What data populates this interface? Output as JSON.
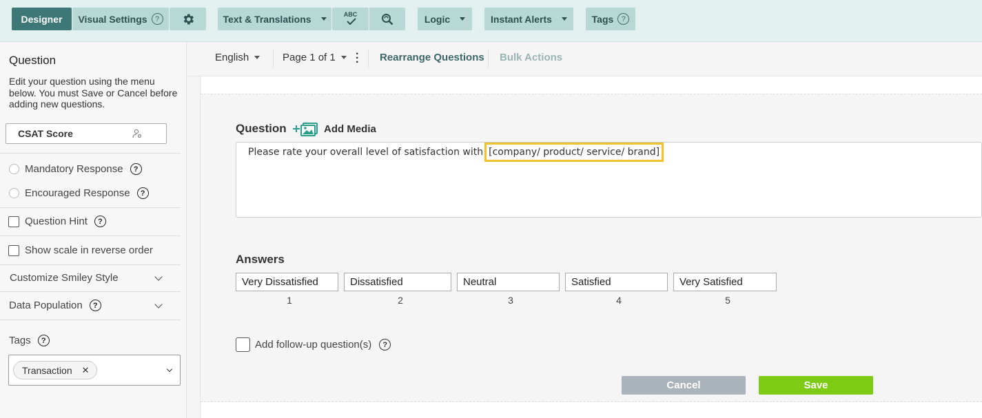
{
  "toolbar": {
    "designer": "Designer",
    "visual_settings": "Visual Settings",
    "text_translations": "Text & Translations",
    "spellcheck_abc": "ABC",
    "logic": "Logic",
    "instant_alerts": "Instant Alerts",
    "tags": "Tags",
    "help_glyph": "?"
  },
  "subbar": {
    "language": "English",
    "page": "Page 1 of 1",
    "rearrange": "Rearrange Questions",
    "bulk": "Bulk Actions"
  },
  "sidebar": {
    "title": "Question",
    "description": "Edit your question using the menu below. You must Save or Cancel before adding new questions.",
    "question_name": "CSAT Score",
    "mandatory": "Mandatory Response",
    "encouraged": "Encouraged Response",
    "hint": "Question Hint",
    "reverse": "Show scale in reverse order",
    "smiley": "Customize Smiley Style",
    "data_population": "Data Population",
    "tags_label": "Tags",
    "tag_chip": "Transaction",
    "chip_remove": "✕"
  },
  "editor": {
    "question_label": "Question",
    "add_media": "Add Media",
    "question_text_prefix": "Please rate your overall level of satisfaction with",
    "question_text_highlight": "[company/ product/ service/ brand]",
    "answers_label": "Answers",
    "answers": [
      {
        "label": "Very Dissatisfied",
        "value": "1"
      },
      {
        "label": "Dissatisfied",
        "value": "2"
      },
      {
        "label": "Neutral",
        "value": "3"
      },
      {
        "label": "Satisfied",
        "value": "4"
      },
      {
        "label": "Very Satisfied",
        "value": "5"
      }
    ],
    "follow_up": "Add follow-up question(s)",
    "cancel": "Cancel",
    "save": "Save"
  },
  "colors": {
    "toolbar_bg": "#e2f0ef",
    "button_bg": "#b7d8d5",
    "active_bg": "#3d7777",
    "highlight": "#f2c12e",
    "save_green": "#7dcb14",
    "cancel_grey": "#aab3bb"
  }
}
